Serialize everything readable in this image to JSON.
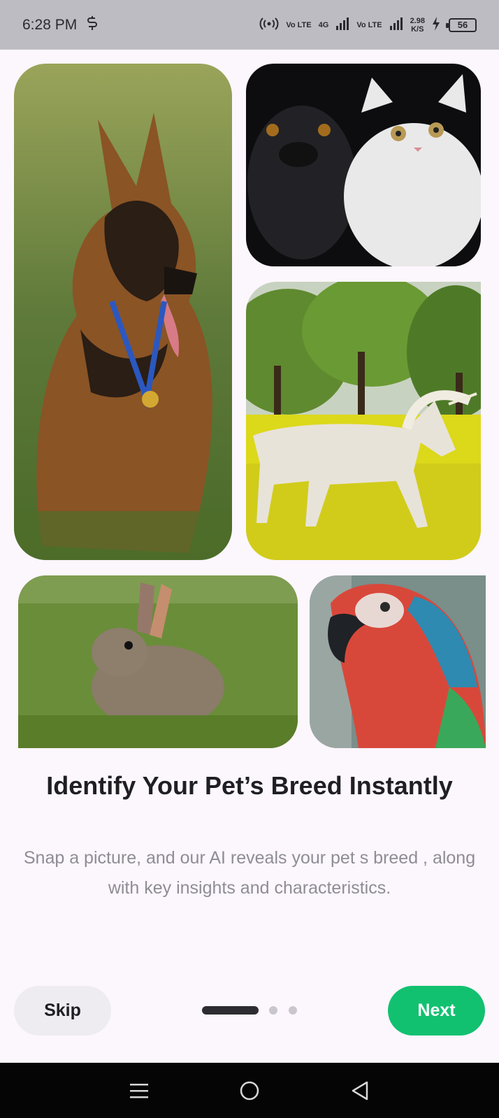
{
  "status_bar": {
    "time": "6:28 PM",
    "net_speed_value": "2.98",
    "net_speed_unit": "K/S",
    "battery": "56",
    "network_labels": [
      "Vo LTE",
      "4G",
      "Vo LTE"
    ]
  },
  "onboarding": {
    "images": [
      "german-shepherd",
      "pug-and-white-cat",
      "white-unicorn",
      "rabbit",
      "macaw-parrot"
    ],
    "title": "Identify Your Pet’s Breed Instantly",
    "subtitle": "Snap a picture, and our AI reveals your pet s breed , along with key insights and characteristics.",
    "page_indicator": {
      "current": 1,
      "total": 3
    }
  },
  "actions": {
    "skip_label": "Skip",
    "next_label": "Next"
  },
  "colors": {
    "accent": "#12c170",
    "background": "#fcf6fd",
    "status_bar": "#bdbcc2"
  },
  "system_nav": {
    "icons": [
      "menu-icon",
      "home-icon",
      "back-icon"
    ]
  }
}
